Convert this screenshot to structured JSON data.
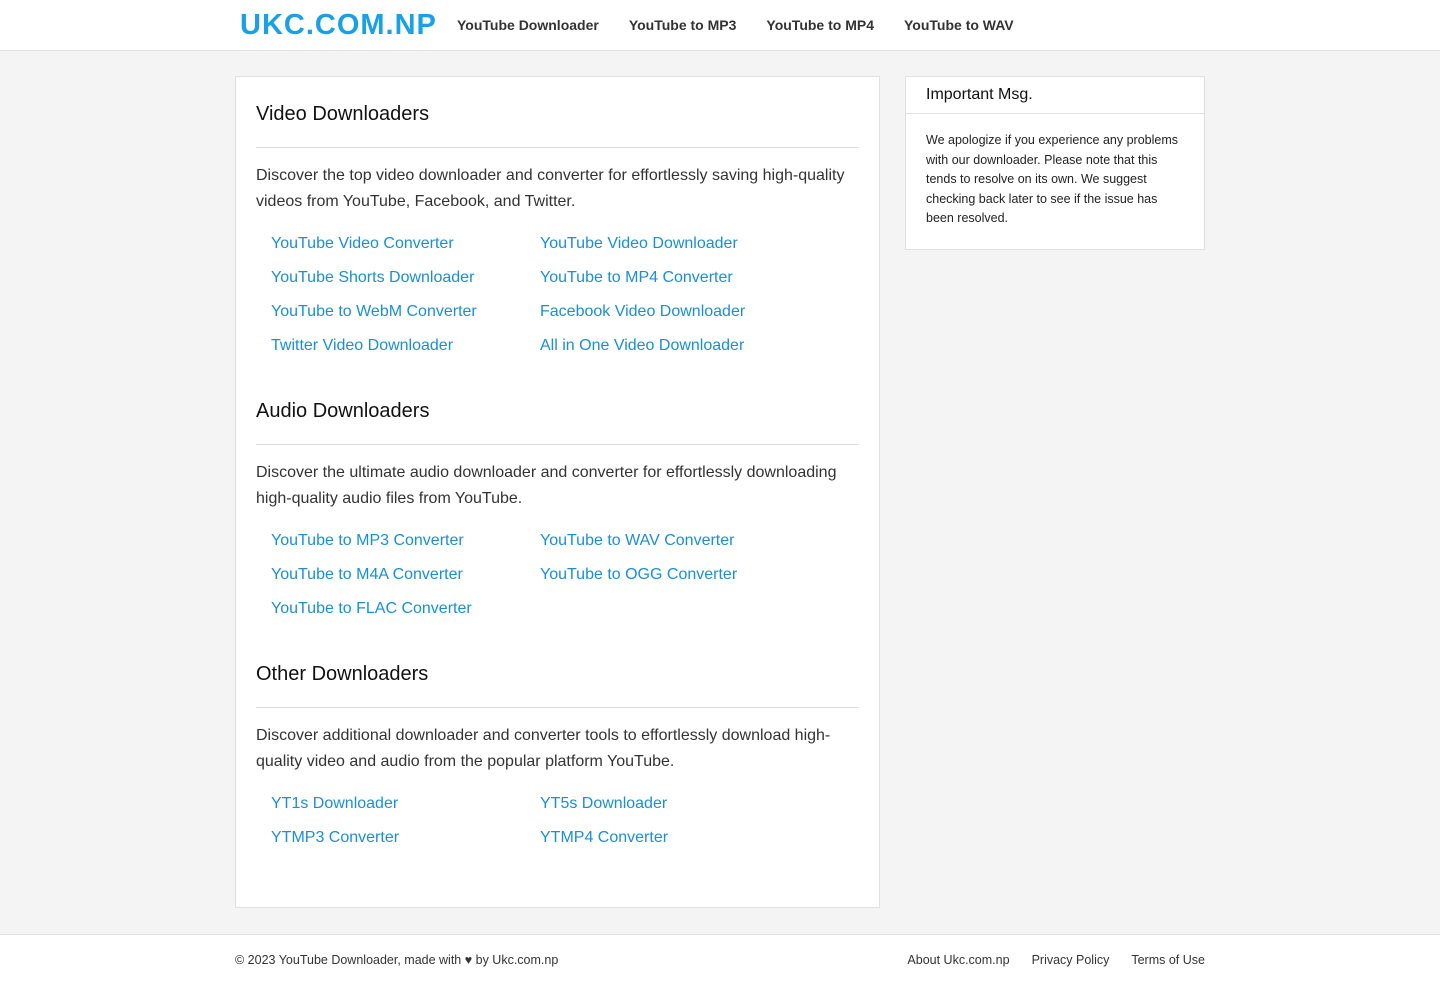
{
  "header": {
    "logo": "UKC.COM.NP",
    "nav": [
      "YouTube Downloader",
      "YouTube to MP3",
      "YouTube to MP4",
      "YouTube to WAV"
    ]
  },
  "sections": [
    {
      "title": "Video Downloaders",
      "description": "Discover the top video downloader and converter for effortlessly saving high-quality videos from YouTube, Facebook, and Twitter.",
      "links": [
        "YouTube Video Converter",
        "YouTube Video Downloader",
        "YouTube Shorts Downloader",
        "YouTube to MP4 Converter",
        "YouTube to WebM Converter",
        "Facebook Video Downloader",
        "Twitter Video Downloader",
        "All in One Video Downloader"
      ]
    },
    {
      "title": "Audio Downloaders",
      "description": "Discover the ultimate audio downloader and converter for effortlessly downloading high-quality audio files from YouTube.",
      "links": [
        "YouTube to MP3 Converter",
        "YouTube to WAV Converter",
        "YouTube to M4A Converter",
        "YouTube to OGG Converter",
        "YouTube to FLAC Converter"
      ]
    },
    {
      "title": "Other Downloaders",
      "description": "Discover additional downloader and converter tools to effortlessly download high-quality video and audio from the popular platform YouTube.",
      "links": [
        "YT1s Downloader",
        "YT5s Downloader",
        "YTMP3 Converter",
        "YTMP4 Converter"
      ]
    }
  ],
  "sidebar": {
    "title": "Important Msg.",
    "message": "We apologize if you experience any problems with our downloader. Please note that this tends to resolve on its own. We suggest checking back later to see if the issue has been resolved."
  },
  "footer": {
    "copyright": "© 2023 YouTube Downloader, made with ♥ by Ukc.com.np",
    "links": [
      "About Ukc.com.np",
      "Privacy Policy",
      "Terms of Use"
    ]
  }
}
